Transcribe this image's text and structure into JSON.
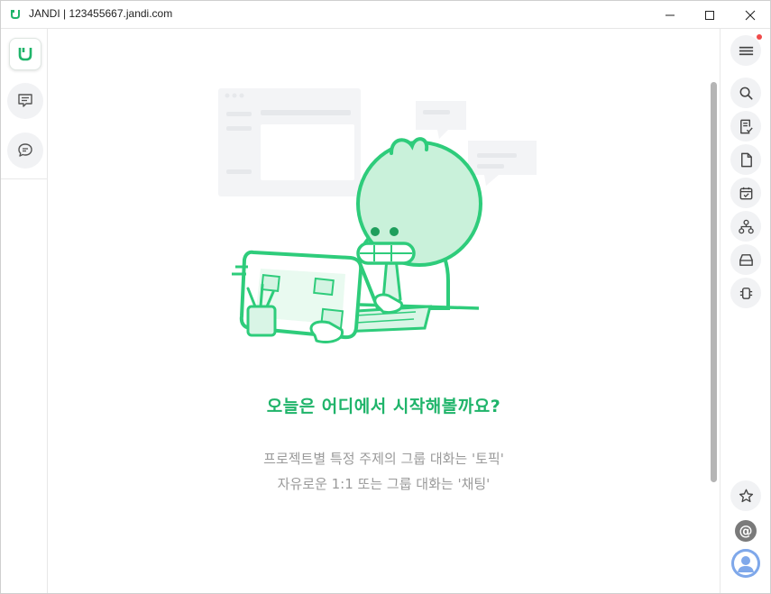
{
  "window": {
    "title": "JANDI | 123455667.jandi.com"
  },
  "left_rail": {
    "items": [
      {
        "name": "jandi-logo-icon"
      },
      {
        "name": "topic-list-icon"
      },
      {
        "name": "chat-bubble-icon"
      }
    ]
  },
  "main": {
    "heading": "오늘은 어디에서 시작해볼까요?",
    "desc_line1": "프로젝트별 특정 주제의 그룹 대화는 '토픽'",
    "desc_line2": "자유로운 1:1 또는 그룹 대화는 '채팅'"
  },
  "right_rail": {
    "items": [
      {
        "name": "menu-icon"
      },
      {
        "name": "search-icon"
      },
      {
        "name": "todo-icon"
      },
      {
        "name": "file-icon"
      },
      {
        "name": "calendar-check-icon"
      },
      {
        "name": "org-chart-icon"
      },
      {
        "name": "inbox-icon"
      },
      {
        "name": "connect-icon"
      },
      {
        "name": "star-icon"
      },
      {
        "name": "mention-icon"
      },
      {
        "name": "profile-avatar"
      }
    ],
    "mention_symbol": "@"
  },
  "colors": {
    "brand_green": "#1fb46a",
    "illustration_green": "#2ecc7b",
    "notification_red": "#f04a4a",
    "muted_text": "#9a9a9a"
  }
}
